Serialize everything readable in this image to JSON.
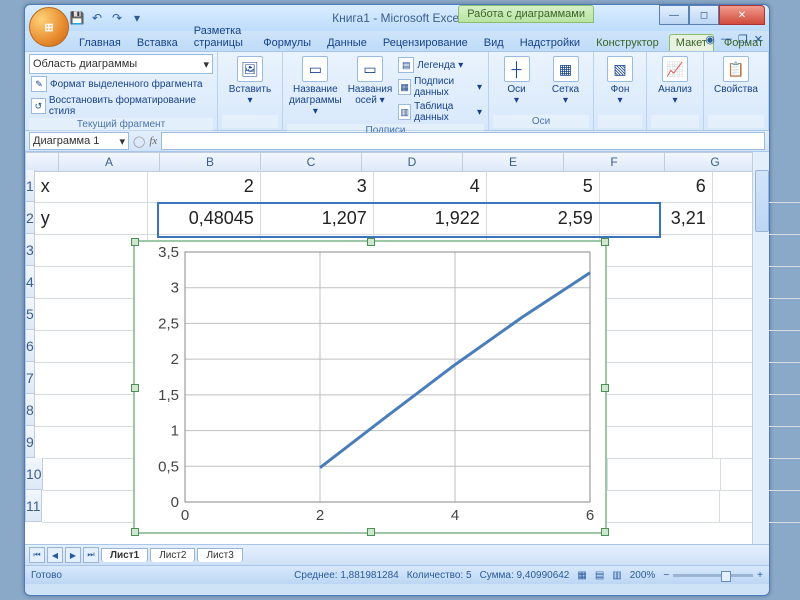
{
  "titlebar": {
    "title": "Книга1 - Microsoft Excel",
    "context_title": "Работа с диаграммами"
  },
  "tabs": {
    "items": [
      "Главная",
      "Вставка",
      "Разметка страницы",
      "Формулы",
      "Данные",
      "Рецензирование",
      "Вид",
      "Надстройки"
    ],
    "context_items": [
      "Конструктор",
      "Макет",
      "Формат"
    ],
    "active": "Макет"
  },
  "ribbon": {
    "selection_group": {
      "combo": "Область диаграммы",
      "format_sel": "Формат выделенного фрагмента",
      "reset": "Восстановить форматирование стиля",
      "title": "Текущий фрагмент"
    },
    "insert": {
      "label": "Вставить",
      "title": ""
    },
    "labels_group": {
      "title": "Подписи",
      "b1": "Название диаграммы",
      "b2": "Названия осей",
      "s1": "Легенда",
      "s2": "Подписи данных",
      "s3": "Таблица данных"
    },
    "axes_group": {
      "title": "Оси",
      "b1": "Оси",
      "b2": "Сетка"
    },
    "bg_group": {
      "b1": "Фон"
    },
    "analysis_group": {
      "b1": "Анализ"
    },
    "prop_group": {
      "b1": "Свойства"
    }
  },
  "namebox": "Диаграмма 1",
  "columns": [
    "A",
    "B",
    "C",
    "D",
    "E",
    "F",
    "G"
  ],
  "rows": [
    "1",
    "2",
    "3",
    "4",
    "5",
    "6",
    "7",
    "8",
    "9",
    "10",
    "11"
  ],
  "grid": {
    "r1": {
      "A": "x",
      "B": "2",
      "C": "3",
      "D": "4",
      "E": "5",
      "F": "6"
    },
    "r2": {
      "A": "y",
      "B": "0,48045",
      "C": "1,207",
      "D": "1,922",
      "E": "2,59",
      "F": "3,21"
    }
  },
  "sheet_tabs": [
    "Лист1",
    "Лист2",
    "Лист3"
  ],
  "status": {
    "ready": "Готово",
    "avg": "Среднее: 1,881981284",
    "count": "Количество: 5",
    "sum": "Сумма: 9,40990642",
    "zoom": "200%"
  },
  "chart_data": {
    "type": "line",
    "x": [
      2,
      3,
      4,
      5,
      6
    ],
    "values": [
      0.48045,
      1.207,
      1.922,
      2.59,
      3.21
    ],
    "xlim": [
      0,
      6
    ],
    "ylim": [
      0,
      3.5
    ],
    "xticks": [
      0,
      2,
      4,
      6
    ],
    "yticks": [
      0,
      0.5,
      1,
      1.5,
      2,
      2.5,
      3,
      3.5
    ],
    "ytick_labels": [
      "0",
      "0,5",
      "1",
      "1,5",
      "2",
      "2,5",
      "3",
      "3,5"
    ]
  }
}
